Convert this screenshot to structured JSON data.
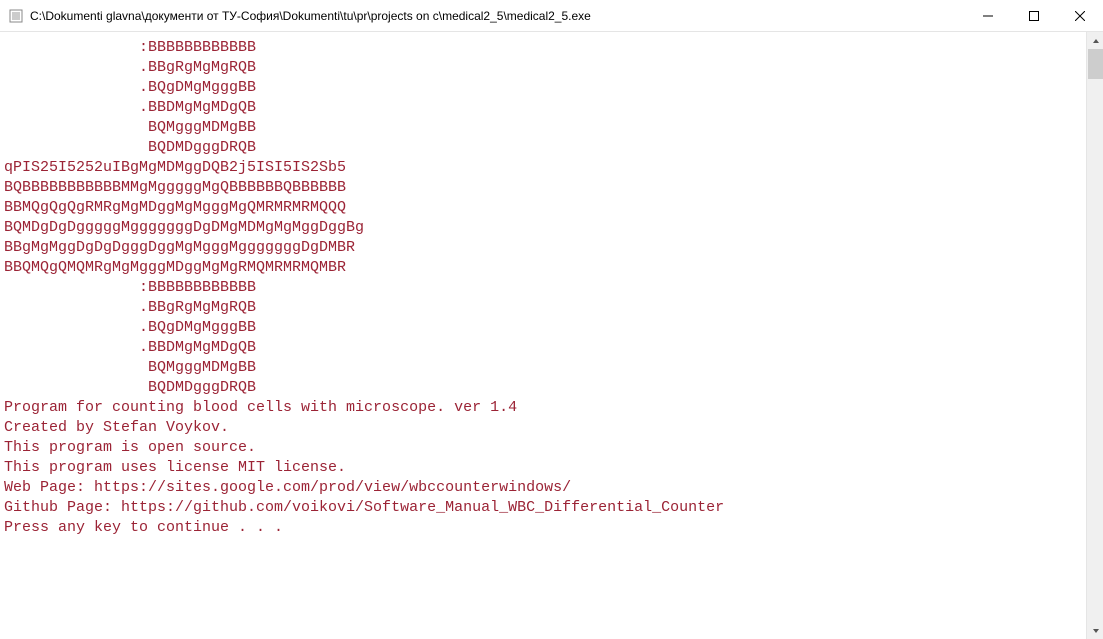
{
  "window": {
    "title": "C:\\Dokumenti glavna\\документи от ТУ-София\\Dokumenti\\tu\\pr\\projects on c\\medical2_5\\medical2_5.exe"
  },
  "console": {
    "lines": [
      "               :BBBBBBBBBBBB",
      "               .BBgRgMgMgRQB",
      "               .BQgDMgMgggBB",
      "               .BBDMgMgMDgQB",
      "                BQMgggMDMgBB",
      "                BQDMDgggDRQB",
      "qPIS25I5252uIBgMgMDMggDQB2j5ISI5IS2Sb5",
      "BQBBBBBBBBBBBMMgMgggggMgQBBBBBBQBBBBBB",
      "BBMQgQgQgRMRgMgMDggMgMgggMgQMRMRMRMQQQ",
      "BQMDgDgDgggggMgggggggDgDMgMDMgMgMggDggBg",
      "BBgMgMggDgDgDgggDggMgMgggMgggggggDgDMBR",
      "BBQMQgQMQMRgMgMgggMDggMgMgRMQMRMRMQMBR",
      "               :BBBBBBBBBBBB",
      "               .BBgRgMgMgRQB",
      "               .BQgDMgMgggBB",
      "               .BBDMgMgMDgQB",
      "                BQMgggMDMgBB",
      "                BQDMDgggDRQB",
      "",
      "Program for counting blood cells with microscope. ver 1.4",
      "Created by Stefan Voykov.",
      "This program is open source.",
      "This program uses license MIT license.",
      "Web Page: https://sites.google.com/prod/view/wbccounterwindows/",
      "Github Page: https://github.com/voikovi/Software_Manual_WBC_Differential_Counter",
      "Press any key to continue . . ."
    ]
  },
  "colors": {
    "text": "#9b2335",
    "background": "#ffffff"
  }
}
